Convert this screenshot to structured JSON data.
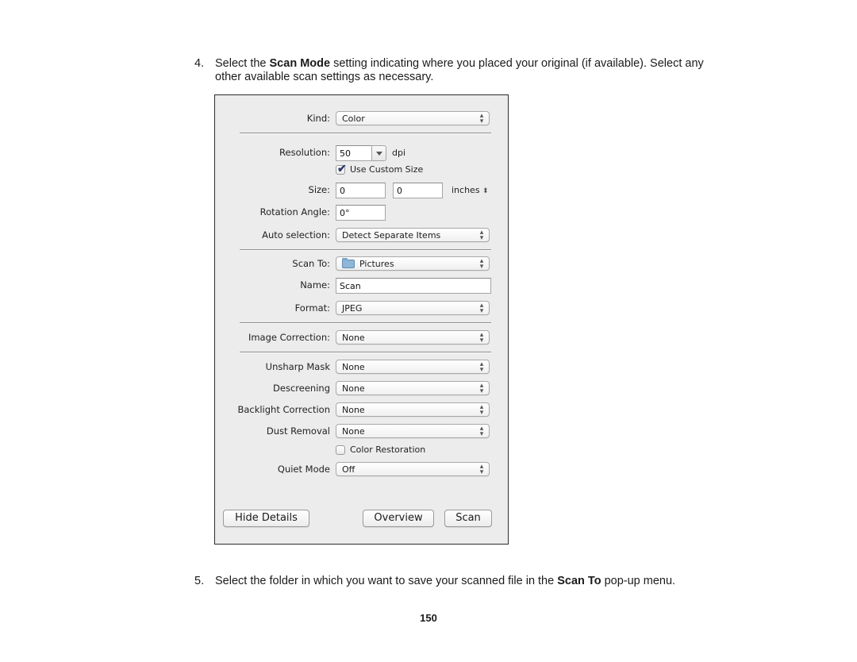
{
  "document": {
    "step4": {
      "number": "4.",
      "line1_before": "Select the ",
      "line1_bold": "Scan Mode",
      "line1_after": " setting indicating where you placed your original (if available). Select any",
      "line2": "other available scan settings as necessary."
    },
    "step5": {
      "number": "5.",
      "before": "Select the folder in which you want to save your scanned file in the ",
      "bold": "Scan To",
      "after": " pop-up menu."
    },
    "page_number": "150"
  },
  "dialog": {
    "kind": {
      "label": "Kind:",
      "value": "Color"
    },
    "resolution": {
      "label": "Resolution:",
      "value": "50",
      "unit": "dpi"
    },
    "use_custom_size": {
      "label": "Use Custom Size",
      "checked": true
    },
    "size": {
      "label": "Size:",
      "width": "0",
      "height": "0",
      "unit": "inches"
    },
    "rotation_angle": {
      "label": "Rotation Angle:",
      "value": "0°"
    },
    "auto_selection": {
      "label": "Auto selection:",
      "value": "Detect Separate Items"
    },
    "scan_to": {
      "label": "Scan To:",
      "value": "Pictures",
      "icon": "folder-icon"
    },
    "name": {
      "label": "Name:",
      "value": "Scan"
    },
    "format": {
      "label": "Format:",
      "value": "JPEG"
    },
    "image_correction": {
      "label": "Image Correction:",
      "value": "None"
    },
    "unsharp_mask": {
      "label": "Unsharp Mask",
      "value": "None"
    },
    "descreening": {
      "label": "Descreening",
      "value": "None"
    },
    "backlight_correction": {
      "label": "Backlight Correction",
      "value": "None"
    },
    "dust_removal": {
      "label": "Dust Removal",
      "value": "None"
    },
    "color_restoration": {
      "label": "Color Restoration",
      "checked": false
    },
    "quiet_mode": {
      "label": "Quiet Mode",
      "value": "Off"
    },
    "buttons": {
      "hide_details": "Hide Details",
      "overview": "Overview",
      "scan": "Scan"
    },
    "checkmark_glyph": "✔",
    "popup_arrows": {
      "up": "▴",
      "down": "▾"
    }
  }
}
